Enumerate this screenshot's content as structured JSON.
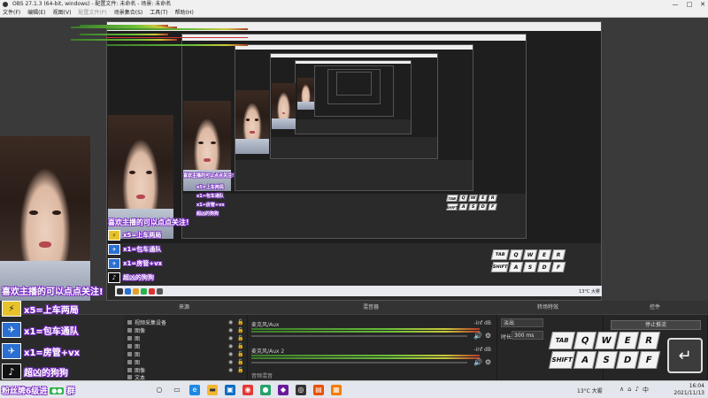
{
  "window": {
    "title": "OBS 27.1.3 (64-bit, windows) - 配置文件: 未命名 - 场景: 未命名"
  },
  "menu": [
    {
      "label": "文件(F)",
      "enabled": true
    },
    {
      "label": "编辑(E)",
      "enabled": true
    },
    {
      "label": "视图(V)",
      "enabled": true
    },
    {
      "label": "配置文件(P)",
      "enabled": false
    },
    {
      "label": "场景集合(S)",
      "enabled": true
    },
    {
      "label": "工具(T)",
      "enabled": true
    },
    {
      "label": "帮助(H)",
      "enabled": true
    }
  ],
  "overlay": {
    "headline": "喜欢主播的可以点点关注!",
    "sticker1": "x5=上车两局",
    "sticker2": "x1=包车通队",
    "sticker3": "x1=房管+vx",
    "sticker4": "超凶的狗狗",
    "fan_badge": "粉丝牌6级进",
    "fan_badge_suffix": "群"
  },
  "keyboard": {
    "row1": [
      "TAB",
      "Q",
      "W",
      "E",
      "R"
    ],
    "row2": [
      "SHIFT",
      "A",
      "S",
      "D",
      "F"
    ]
  },
  "dock": {
    "sources_title": "来源",
    "mixer_title": "混音器",
    "transitions_title": "转场特效",
    "controls_title": "控件",
    "sources": [
      "视频采集设备",
      "图像",
      "图",
      "图",
      "图",
      "图",
      "图像",
      "文本"
    ],
    "tracks": [
      {
        "name": "麦克风/Aux",
        "db": "-inf dB"
      },
      {
        "name": "麦克风/Aux 2",
        "db": "-inf dB"
      }
    ],
    "transition_value": "淡出",
    "duration_label": "时长",
    "duration_value": "300 ms",
    "stop_button": "停止推流",
    "bottom_hint": "音频混音"
  },
  "taskbar": {
    "weather": "13°C 大雾",
    "time": "16:04",
    "date": "2021/11/13"
  },
  "colors": {
    "accent_purple": "#7a2cc4",
    "meter_green": "#6abe3a",
    "panel_bg": "#262626"
  }
}
